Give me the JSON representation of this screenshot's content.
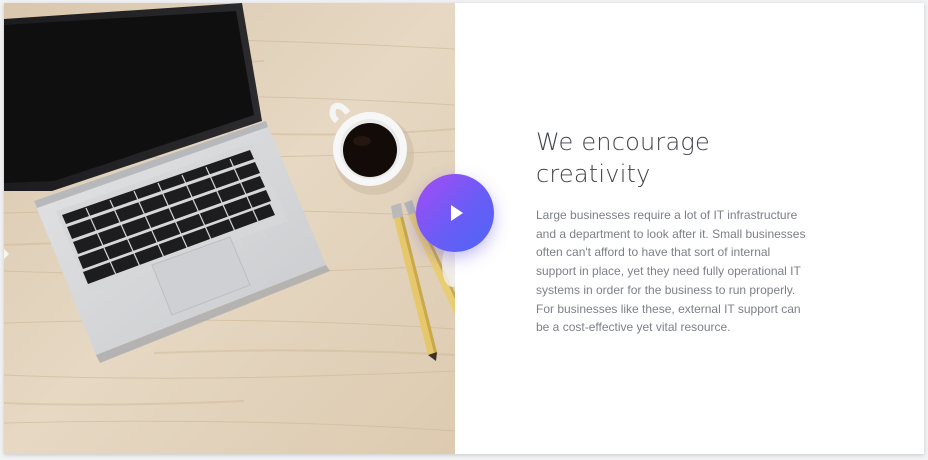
{
  "feature": {
    "heading": "We encourage creativity",
    "body": "Large businesses require a lot of IT infrastructure and a department to look after it. Small businesses often can't afford to have that sort of internal support in place, yet they need fully operational IT systems in order for the business to run properly. For businesses like these, external IT support can be a cost-effective yet vital resource."
  },
  "media": {
    "image_subject": "laptop, coffee cup and pencils on a wooden desk",
    "play_button_icon": "play-icon"
  },
  "colors": {
    "play_gradient_start": "#a64bf4",
    "play_gradient_end": "#4d66f7",
    "heading": "#3f4247",
    "body": "#7c8088",
    "background": "#ffffff"
  }
}
